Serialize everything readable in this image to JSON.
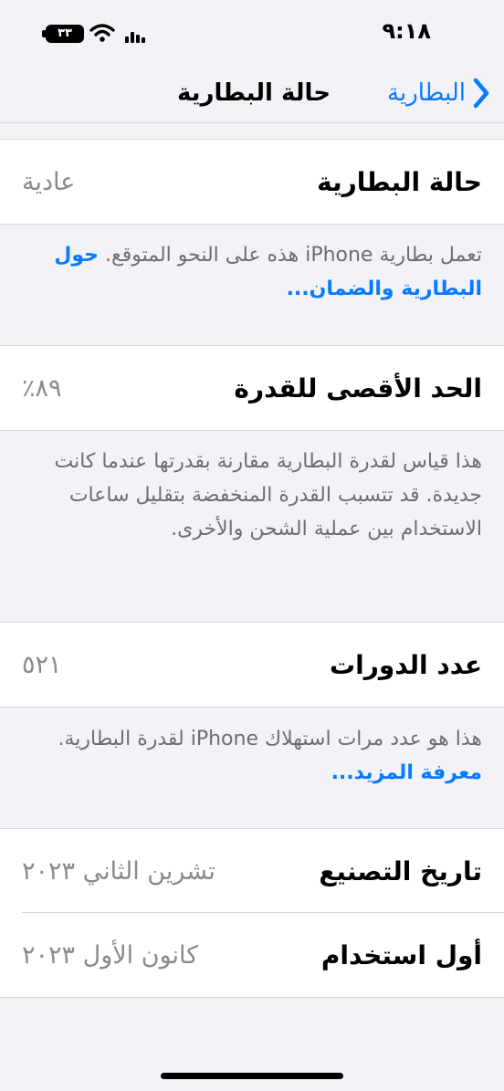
{
  "status_bar": {
    "time": "٩:١٨",
    "battery_level": "٣٣",
    "icons": [
      "battery-icon",
      "wifi-icon",
      "signal-icon"
    ]
  },
  "nav": {
    "back_label": "البطارية",
    "title": "حالة البطارية"
  },
  "battery_condition": {
    "label": "حالة البطارية",
    "value": "عادية",
    "note": "تعمل بطارية iPhone هذه على النحو المتوقع.",
    "link": "حول البطارية والضمان..."
  },
  "maximum_capacity": {
    "label": "الحد الأقصى للقدرة",
    "value": "٨٩٪",
    "note": "هذا قياس لقدرة البطارية مقارنة بقدرتها عندما كانت جديدة. قد تتسبب القدرة المنخفضة بتقليل ساعات الاستخدام بين عملية الشحن والأخرى."
  },
  "cycle_count": {
    "label": "عدد الدورات",
    "value": "٥٢١",
    "note": "هذا هو عدد مرات استهلاك iPhone لقدرة البطارية.",
    "link": "معرفة المزيد..."
  },
  "manufacture_date": {
    "label": "تاريخ التصنيع",
    "value": "تشرين الثاني ٢٠٢٣"
  },
  "first_use": {
    "label": "أول استخدام",
    "value": "كانون الأول ٢٠٢٣"
  },
  "colors": {
    "accent": "#0a7aff",
    "background": "#f2f2f7",
    "secondary_text": "#8a8a8e"
  }
}
